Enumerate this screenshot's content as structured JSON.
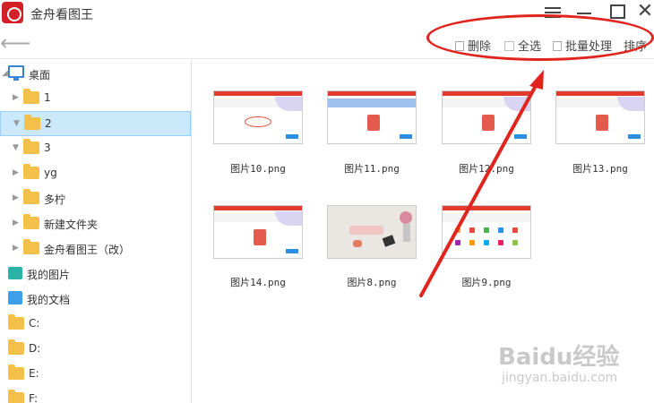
{
  "app": {
    "title": "金舟看图王"
  },
  "toolbar": {
    "delete_label": "删除",
    "selectall_label": "全选",
    "batch_label": "批量处理",
    "sort_label": "排序"
  },
  "sidebar": {
    "items": [
      {
        "label": "桌面"
      },
      {
        "label": "1"
      },
      {
        "label": "2"
      },
      {
        "label": "3"
      },
      {
        "label": "yg"
      },
      {
        "label": "多柠"
      },
      {
        "label": "新建文件夹"
      },
      {
        "label": "金舟看图王（改）"
      },
      {
        "label": "我的图片"
      },
      {
        "label": "我的文档"
      },
      {
        "label": "C:"
      },
      {
        "label": "D:"
      },
      {
        "label": "E:"
      },
      {
        "label": "F:"
      }
    ]
  },
  "files": [
    {
      "name": "图片10.png"
    },
    {
      "name": "图片11.png"
    },
    {
      "name": "图片12.png"
    },
    {
      "name": "图片13.png"
    },
    {
      "name": "图片14.png"
    },
    {
      "name": "图片8.png"
    },
    {
      "name": "图片9.png"
    }
  ],
  "watermark": {
    "logo": "Baidu经验",
    "url": "jingyan.baidu.com"
  },
  "colors": {
    "accent": "#e0241e",
    "selection": "#cce8fb",
    "folder": "#f5c04a"
  }
}
